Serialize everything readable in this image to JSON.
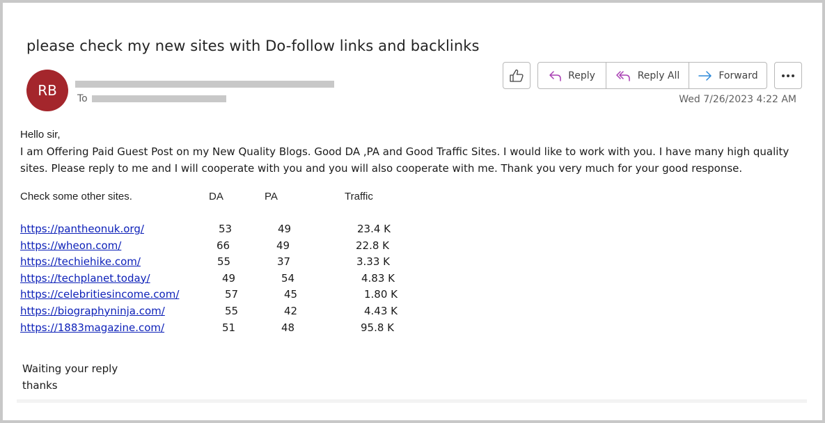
{
  "email": {
    "subject": "please check my new sites with Do-follow links and backlinks",
    "sender": {
      "initials": "RB",
      "avatar_color": "#a4262c",
      "name_redacted": true
    },
    "to_label": "To",
    "timestamp": "Wed 7/26/2023 4:22 AM"
  },
  "actions": {
    "like_icon": "thumbs-up-icon",
    "reply": "Reply",
    "reply_all": "Reply All",
    "forward": "Forward",
    "more_icon": "more-options-icon"
  },
  "body": {
    "greeting": "Hello sir,",
    "paragraph": "I am Offering Paid Guest Post on my New Quality Blogs. Good DA ,PA and Good Traffic Sites. I would like to work with you. I have many high quality sites. Please reply to me and I will cooperate with you and you will also cooperate with me. Thank you very much for your good response.",
    "table": {
      "intro": "Check some other sites.",
      "headers": [
        "DA",
        "PA",
        "Traffic"
      ],
      "rows": [
        {
          "url": "https://pantheonuk.org/",
          "da": "53",
          "pa": "49",
          "traffic": "23.4 K"
        },
        {
          "url": "https://wheon.com/",
          "da": "66",
          "pa": "49",
          "traffic": "22.8 K"
        },
        {
          "url": "https://techiehike.com/",
          "da": "55",
          "pa": "37",
          "traffic": "3.33 K"
        },
        {
          "url": "https://techplanet.today/",
          "da": "49",
          "pa": "54",
          "traffic": "4.83 K"
        },
        {
          "url": "https://celebritiesincome.com/",
          "da": "57",
          "pa": "45",
          "traffic": "1.80 K"
        },
        {
          "url": "https://biographyninja.com/",
          "da": "55",
          "pa": "42",
          "traffic": "4.43 K"
        },
        {
          "url": "https://1883magazine.com/",
          "da": "51",
          "pa": "48",
          "traffic": "95.8 K"
        }
      ]
    },
    "closing_1": "Waiting your reply",
    "closing_2": "thanks"
  }
}
